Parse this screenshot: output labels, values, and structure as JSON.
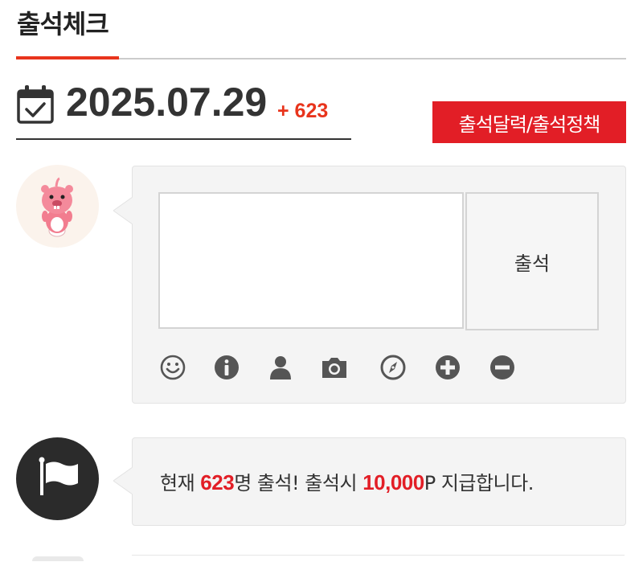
{
  "header": {
    "title": "출석체크"
  },
  "attendance": {
    "date": "2025.07.29",
    "delta": "+ 623",
    "policy_button": "출석달력/출석정책"
  },
  "comment": {
    "input_placeholder": "",
    "submit_label": "출석",
    "toolbar": [
      {
        "name": "emoticon-icon"
      },
      {
        "name": "info-icon"
      },
      {
        "name": "user-icon"
      },
      {
        "name": "camera-icon"
      },
      {
        "name": "compass-icon"
      },
      {
        "name": "plus-icon"
      },
      {
        "name": "minus-icon"
      }
    ]
  },
  "notice": {
    "prefix": "현재 ",
    "count": "623",
    "middle": "명 출석! 출석시 ",
    "points": "10,000",
    "suffix": "P 지급합니다."
  },
  "colors": {
    "accent": "#e8341c",
    "button_red": "#e21e26",
    "highlight_red": "#e21e26",
    "icon_gray": "#555555"
  }
}
